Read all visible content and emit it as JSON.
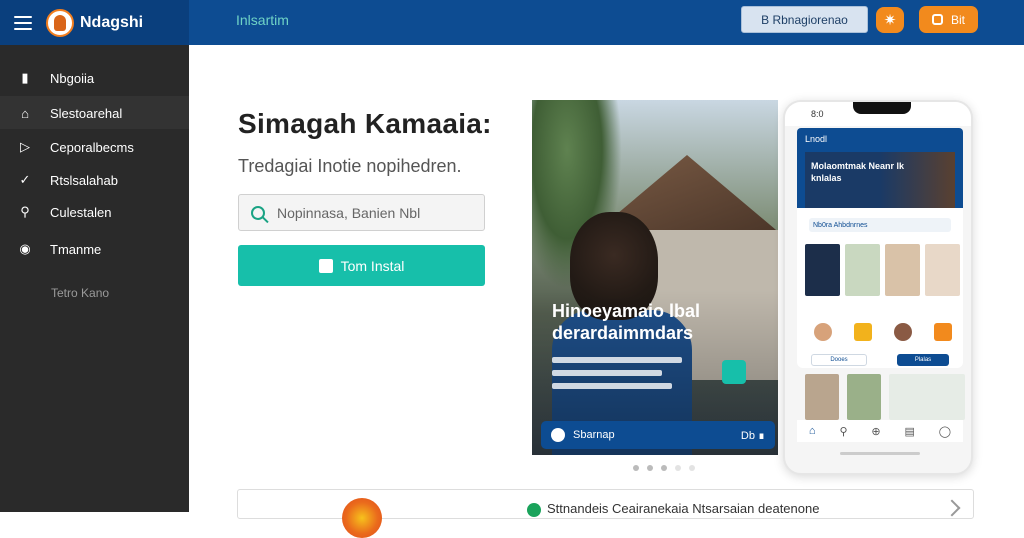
{
  "app": {
    "brand_name": "Ndagshi",
    "top_tab": "Inlsartim",
    "top_search_label": "B Rbnagiorenao",
    "top_action_label": "Bit",
    "accent_color": "#17bfaa",
    "brand_color": "#0d4c92",
    "orange": "#f28a1d"
  },
  "sidebar": {
    "items": [
      {
        "label": "Nbgoiia",
        "icon": "bag-icon"
      },
      {
        "label": "Slestoarehal",
        "icon": "home-icon"
      },
      {
        "label": "Ceporalbecms",
        "icon": "play-icon"
      },
      {
        "label": "Rtslsalahab",
        "icon": "check-icon"
      },
      {
        "label": "Culestalen",
        "icon": "link-icon"
      },
      {
        "label": "Tmanme",
        "icon": "video-icon"
      }
    ],
    "footer": "Tetro Kano"
  },
  "main": {
    "headline": "Simagah Kamaaia:",
    "subline": "Tredagiai Inotie nopihedren.",
    "search_placeholder": "Nopinnasa, Banien Nbl",
    "cta_label": "Tom Instal"
  },
  "hero": {
    "title": "Hinoeyamaio lbal derardaimmdars",
    "bar_left": "Sbarnap",
    "bar_right": "Db ∎"
  },
  "phone": {
    "time": "8:0",
    "header_title": "Lnodl",
    "banner_text": "Molaomtmak Neanr lk knlalas",
    "chip_text": "Nb0ra Ahbdnrnes",
    "pill_a": "Dooes",
    "pill_b": "Plalas"
  },
  "strip": {
    "text": "Sttnandeis Ceairanekaia Ntsarsaian deatenone"
  }
}
